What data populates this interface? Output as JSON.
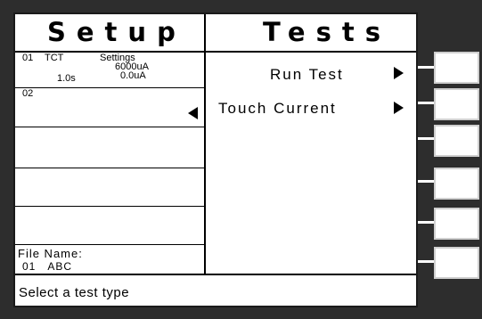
{
  "header": {
    "left_title": "Setup",
    "right_title": "Tests"
  },
  "slots": [
    {
      "number": "01",
      "type": "TCT",
      "settings_label": "Settings",
      "time": "1.0s",
      "limit_high": "6000uA",
      "limit_low": "0.0uA"
    },
    {
      "number": "02"
    }
  ],
  "file": {
    "label": "File Name:",
    "number": "01",
    "name": "ABC"
  },
  "menu": {
    "items": [
      {
        "label": "Run Test"
      },
      {
        "label": "Touch Current"
      }
    ]
  },
  "status": {
    "message": "Select a test type"
  }
}
